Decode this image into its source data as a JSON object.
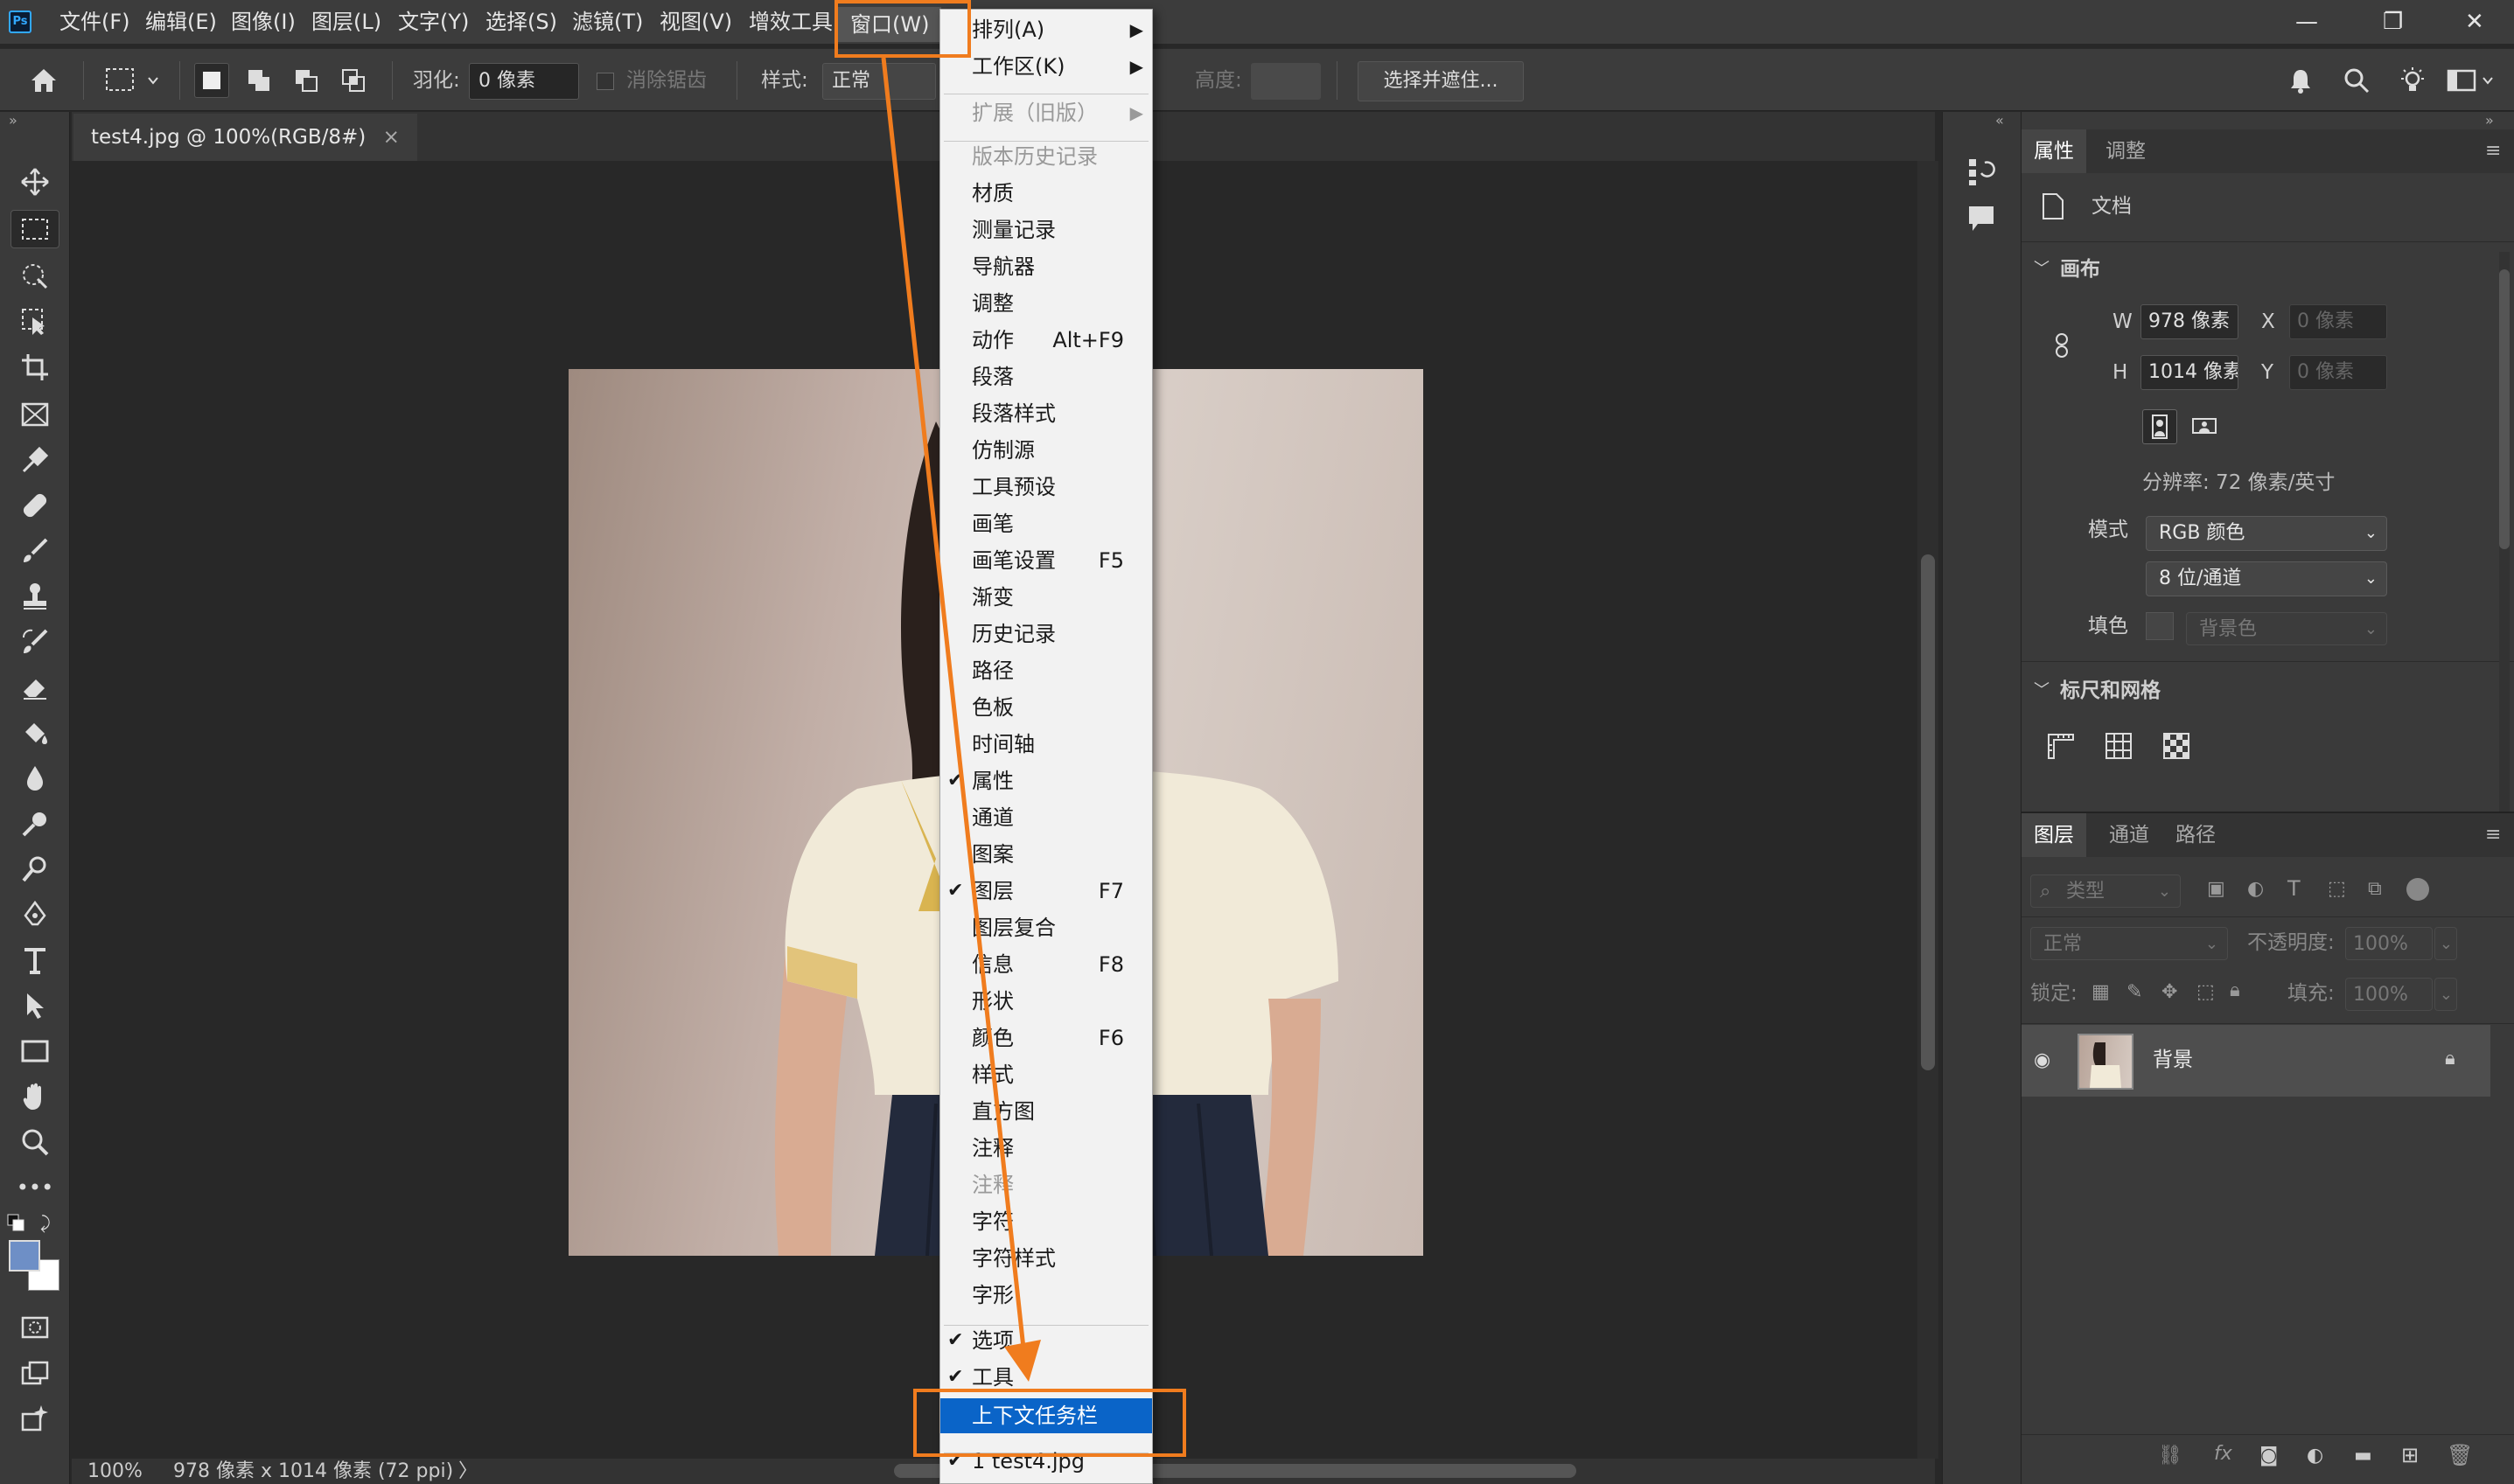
{
  "app": {
    "logo_text": "Ps"
  },
  "menubar": {
    "items": [
      "文件(F)",
      "编辑(E)",
      "图像(I)",
      "图层(L)",
      "文字(Y)",
      "选择(S)",
      "滤镜(T)",
      "视图(V)",
      "增效工具",
      "窗口(W)"
    ],
    "window_controls": {
      "minimize": "—",
      "maximize": "❐",
      "close": "✕"
    }
  },
  "options": {
    "feather_label": "羽化:",
    "feather_value": "0 像素",
    "antialias_label": "消除锯齿",
    "style_label": "样式:",
    "style_value": "正常",
    "height_label": "高度:",
    "select_mask_button": "选择并遮住..."
  },
  "document": {
    "tab_title": "test4.jpg @ 100%(RGB/8#)",
    "tab_close": "×"
  },
  "status": {
    "zoom": "100%",
    "info": "978 像素 x 1014 像素 (72 ppi)",
    "arrow": "〉"
  },
  "window_menu": {
    "items": [
      {
        "label": "排列(A)",
        "shortcut": "",
        "submenu": true,
        "checked": false,
        "disabled": false
      },
      {
        "label": "工作区(K)",
        "shortcut": "",
        "submenu": true,
        "checked": false,
        "disabled": false
      },
      {
        "label": "扩展（旧版）",
        "shortcut": "",
        "submenu": true,
        "checked": false,
        "disabled": true
      },
      {
        "label": "版本历史记录",
        "shortcut": "",
        "submenu": false,
        "checked": false,
        "disabled": true
      },
      {
        "label": "材质",
        "shortcut": "",
        "submenu": false,
        "checked": false,
        "disabled": false
      },
      {
        "label": "测量记录",
        "shortcut": "",
        "submenu": false,
        "checked": false,
        "disabled": false
      },
      {
        "label": "导航器",
        "shortcut": "",
        "submenu": false,
        "checked": false,
        "disabled": false
      },
      {
        "label": "调整",
        "shortcut": "",
        "submenu": false,
        "checked": false,
        "disabled": false
      },
      {
        "label": "动作",
        "shortcut": "Alt+F9",
        "submenu": false,
        "checked": false,
        "disabled": false
      },
      {
        "label": "段落",
        "shortcut": "",
        "submenu": false,
        "checked": false,
        "disabled": false
      },
      {
        "label": "段落样式",
        "shortcut": "",
        "submenu": false,
        "checked": false,
        "disabled": false
      },
      {
        "label": "仿制源",
        "shortcut": "",
        "submenu": false,
        "checked": false,
        "disabled": false
      },
      {
        "label": "工具预设",
        "shortcut": "",
        "submenu": false,
        "checked": false,
        "disabled": false
      },
      {
        "label": "画笔",
        "shortcut": "",
        "submenu": false,
        "checked": false,
        "disabled": false
      },
      {
        "label": "画笔设置",
        "shortcut": "F5",
        "submenu": false,
        "checked": false,
        "disabled": false
      },
      {
        "label": "渐变",
        "shortcut": "",
        "submenu": false,
        "checked": false,
        "disabled": false
      },
      {
        "label": "历史记录",
        "shortcut": "",
        "submenu": false,
        "checked": false,
        "disabled": false
      },
      {
        "label": "路径",
        "shortcut": "",
        "submenu": false,
        "checked": false,
        "disabled": false
      },
      {
        "label": "色板",
        "shortcut": "",
        "submenu": false,
        "checked": false,
        "disabled": false
      },
      {
        "label": "时间轴",
        "shortcut": "",
        "submenu": false,
        "checked": false,
        "disabled": false
      },
      {
        "label": "属性",
        "shortcut": "",
        "submenu": false,
        "checked": true,
        "disabled": false
      },
      {
        "label": "通道",
        "shortcut": "",
        "submenu": false,
        "checked": false,
        "disabled": false
      },
      {
        "label": "图案",
        "shortcut": "",
        "submenu": false,
        "checked": false,
        "disabled": false
      },
      {
        "label": "图层",
        "shortcut": "F7",
        "submenu": false,
        "checked": true,
        "disabled": false
      },
      {
        "label": "图层复合",
        "shortcut": "",
        "submenu": false,
        "checked": false,
        "disabled": false
      },
      {
        "label": "信息",
        "shortcut": "F8",
        "submenu": false,
        "checked": false,
        "disabled": false
      },
      {
        "label": "形状",
        "shortcut": "",
        "submenu": false,
        "checked": false,
        "disabled": false
      },
      {
        "label": "颜色",
        "shortcut": "F6",
        "submenu": false,
        "checked": false,
        "disabled": false
      },
      {
        "label": "样式",
        "shortcut": "",
        "submenu": false,
        "checked": false,
        "disabled": false
      },
      {
        "label": "直方图",
        "shortcut": "",
        "submenu": false,
        "checked": false,
        "disabled": false
      },
      {
        "label": "注释",
        "shortcut": "",
        "submenu": false,
        "checked": false,
        "disabled": false
      },
      {
        "label": "注释",
        "shortcut": "",
        "submenu": false,
        "checked": false,
        "disabled": true
      },
      {
        "label": "字符",
        "shortcut": "",
        "submenu": false,
        "checked": false,
        "disabled": false
      },
      {
        "label": "字符样式",
        "shortcut": "",
        "submenu": false,
        "checked": false,
        "disabled": false
      },
      {
        "label": "字形",
        "shortcut": "",
        "submenu": false,
        "checked": false,
        "disabled": false
      },
      {
        "label": "选项",
        "shortcut": "",
        "submenu": false,
        "checked": true,
        "disabled": false
      },
      {
        "label": "工具",
        "shortcut": "",
        "submenu": false,
        "checked": true,
        "disabled": false
      },
      {
        "label": "上下文任务栏",
        "shortcut": "",
        "submenu": false,
        "checked": false,
        "disabled": false,
        "highlighted": true
      },
      {
        "label": "1 test4.jpg",
        "shortcut": "",
        "submenu": false,
        "checked": true,
        "disabled": false
      }
    ]
  },
  "properties_panel": {
    "tabs": [
      "属性",
      "调整"
    ],
    "doc_label": "文档",
    "canvas_section": "画布",
    "w_label": "W",
    "w_value": "978 像素",
    "h_label": "H",
    "h_value": "1014 像素",
    "x_label": "X",
    "x_value": "0 像素",
    "y_label": "Y",
    "y_value": "0 像素",
    "resolution": "分辨率: 72 像素/英寸",
    "mode_label": "模式",
    "mode_value": "RGB 颜色",
    "depth_value": "8 位/通道",
    "fill_label": "填色",
    "fill_value": "背景色",
    "rulers_section": "标尺和网格"
  },
  "layers_panel": {
    "tabs": [
      "图层",
      "通道",
      "路径"
    ],
    "filter_placeholder": "类型",
    "blend_mode": "正常",
    "opacity_label": "不透明度:",
    "opacity_value": "100%",
    "lock_label": "锁定:",
    "fill_label": "填充:",
    "fill_value": "100%",
    "layers": [
      {
        "name": "背景",
        "locked": true,
        "visible": true
      }
    ]
  },
  "annotation_color": "#f07c1e"
}
